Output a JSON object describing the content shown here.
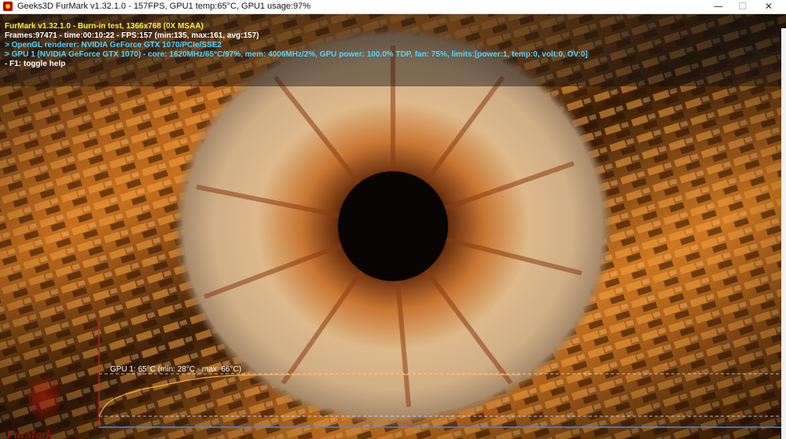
{
  "window": {
    "title": "Geeks3D FurMark v1.32.1.0 - 157FPS, GPU1 temp:65°C, GPU1 usage:97%",
    "minimize_glyph": "—",
    "maximize_glyph": "☐",
    "close_glyph": "✕"
  },
  "hud": {
    "line1": "FurMark v1.32.1.0 - Burn-in test, 1366x768 (0X MSAA)",
    "line2": "Frames:97471 - time:00:10:22 - FPS:157 (min:135, max:161, avg:157)",
    "line3": "> OpenGL renderer: NVIDIA GeForce GTX 1070/PCIe/SSE2",
    "line4": "> GPU 1 (NVIDIA GeForce GTX 1070) - core: 1620MHz/65°C/97%, mem: 4006MHz/2%, GPU power: 100.0% TDP, fan: 75%, limits:[power:1, temp:0, volt:0, OV:0]",
    "line5": "- F1: toggle help"
  },
  "graph": {
    "label": "GPU 1: 65°C (min: 28°C - max: 66°C)",
    "current_c": 65,
    "min_c": 28,
    "max_c": 66,
    "line_color": "#ffaa44",
    "baseline_color": "#3a8cff",
    "axis_color": "#dd2222"
  },
  "logo": {
    "text": "FurMark"
  },
  "colors": {
    "hud_title": "#ffee44",
    "hud_info": "#55d6ff",
    "hud_plain": "#ffffff"
  }
}
